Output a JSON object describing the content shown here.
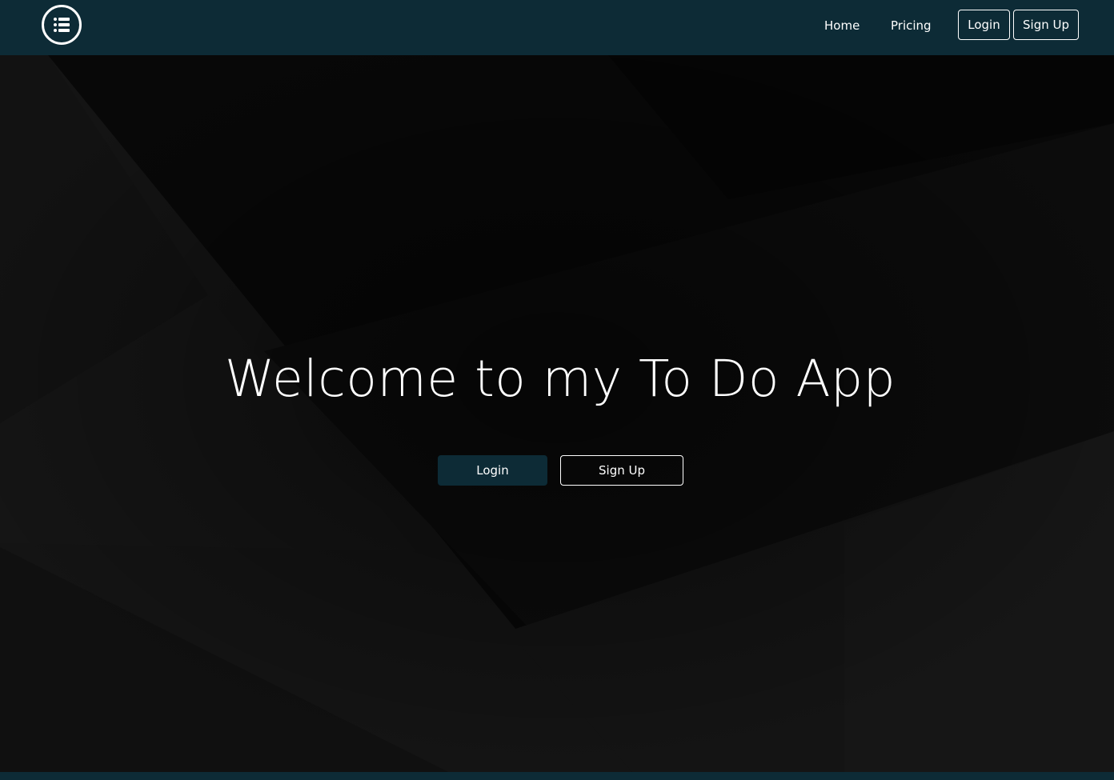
{
  "navbar": {
    "logo_icon": "list-icon",
    "links": {
      "home": "Home",
      "pricing": "Pricing"
    },
    "buttons": {
      "login": "Login",
      "signup": "Sign Up"
    }
  },
  "hero": {
    "title": "Welcome to my To Do App",
    "buttons": {
      "login": "Login",
      "signup": "Sign Up"
    }
  },
  "colors": {
    "brand": "#0d2b36",
    "background": "#070707",
    "text": "#ffffff"
  }
}
